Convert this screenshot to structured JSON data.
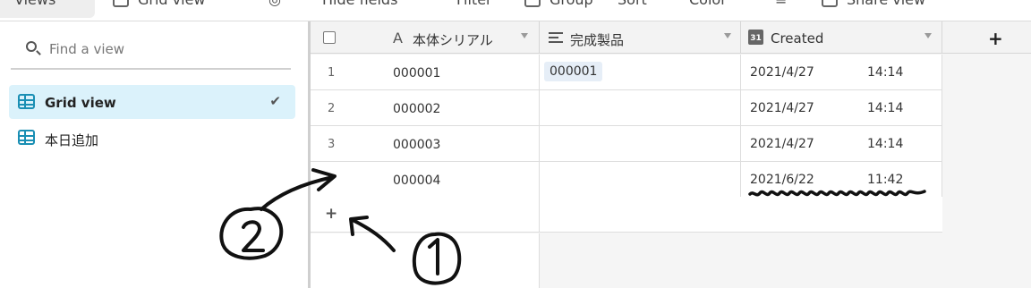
{
  "toolbar": {
    "views_label": "Views",
    "view_name": "Grid view",
    "hide_fields": "Hide fields",
    "filter": "Filter",
    "group": "Group",
    "sort": "Sort",
    "color": "Color",
    "share_view": "Share view"
  },
  "sidebar": {
    "search_placeholder": "Find a view",
    "views": [
      {
        "label": "Grid view",
        "active": true,
        "icon": "grid-icon"
      },
      {
        "label": "本日追加",
        "active": false,
        "icon": "grid-icon"
      }
    ],
    "check_icon": "✔"
  },
  "table": {
    "columns": [
      {
        "label": "本体シリアル",
        "icon": "A"
      },
      {
        "label": "完成製品",
        "icon": "lines-icon"
      },
      {
        "label": "Created",
        "icon": "31"
      }
    ],
    "add_column_label": "+",
    "add_row_label": "+",
    "rows": [
      {
        "num": "1",
        "serial": "000001",
        "product": "000001",
        "date": "2021/4/27",
        "time": "14:14"
      },
      {
        "num": "2",
        "serial": "000002",
        "product": "",
        "date": "2021/4/27",
        "time": "14:14"
      },
      {
        "num": "3",
        "serial": "000003",
        "product": "",
        "date": "2021/4/27",
        "time": "14:14"
      },
      {
        "num": "",
        "serial": "000004",
        "product": "",
        "date": "2021/6/22",
        "time": "11:42"
      }
    ]
  },
  "colors": {
    "accent": "#1a8fb4",
    "active_view_bg": "#dbf2fb",
    "chip_bg": "#e6eef7"
  }
}
